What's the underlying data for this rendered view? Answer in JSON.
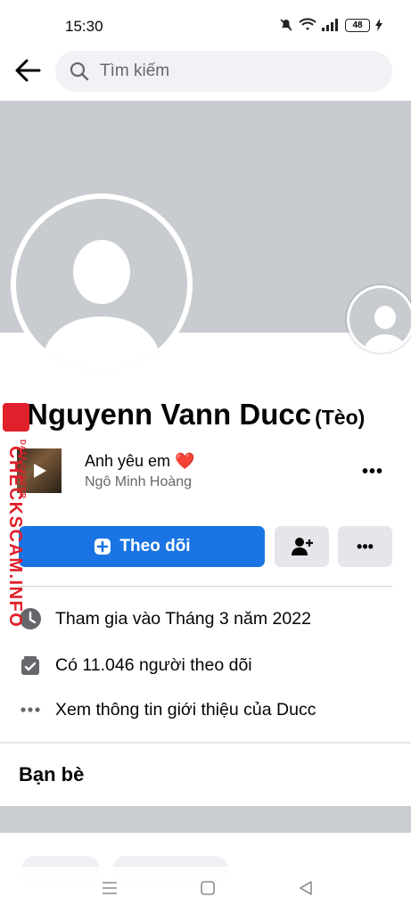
{
  "status_bar": {
    "time": "15:30",
    "battery": "48"
  },
  "search": {
    "placeholder": "Tìm kiếm"
  },
  "profile": {
    "name": "Nguyenn Vann Ducc",
    "nickname": "(Tèo)"
  },
  "music": {
    "title": "Anh yêu em ❤️",
    "artist": "Ngô Minh Hoàng",
    "more": "•••"
  },
  "actions": {
    "follow_label": "Theo dõi",
    "more_label": "•••"
  },
  "info": {
    "joined": "Tham gia vào Tháng 3 năm 2022",
    "followers": "Có 11.046 người theo dõi",
    "about": "Xem thông tin giới thiệu của Ducc"
  },
  "friends": {
    "title": "Bạn bè"
  },
  "watermark": {
    "text": "CHECKSCAM.INFO",
    "sub": "DATA CENTER"
  },
  "colors": {
    "primary": "#1b74e4",
    "cover": "#c8ccd1",
    "watermark": "#e0202b"
  }
}
